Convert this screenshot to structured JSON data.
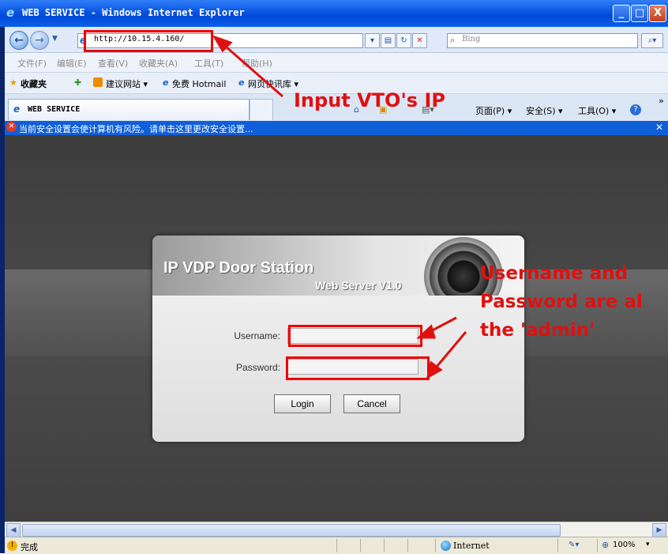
{
  "window": {
    "title": "WEB SERVICE - Windows Internet Explorer",
    "minimize": "_",
    "maximize": "□",
    "close": "X"
  },
  "address_bar": {
    "url": "http://10.15.4.160/",
    "search_placeholder": "Bing"
  },
  "menu": [
    "文件(F)",
    "编辑(E)",
    "查看(V)",
    "收藏夹(A)",
    "工具(T)",
    "帮助(H)"
  ],
  "favorites": {
    "label": "收藏夹",
    "items": [
      "建议网站 ▾",
      "免费 Hotmail",
      "网页快讯库 ▾"
    ]
  },
  "tab": {
    "label": "WEB SERVICE"
  },
  "command_bar": [
    "页面(P) ▾",
    "安全(S) ▾",
    "工具(O) ▾",
    "»"
  ],
  "info_bar": {
    "text": "当前安全设置会使计算机有风险。请单击这里更改安全设置..."
  },
  "login": {
    "title": "IP VDP Door Station",
    "subtitle": "Web Server V1.0",
    "username_label": "Username:",
    "password_label": "Password:",
    "username_value": "",
    "password_value": "",
    "login_button": "Login",
    "cancel_button": "Cancel"
  },
  "annotations": {
    "ip_note": "Input VTO's IP",
    "cred_line1": "Username and",
    "cred_line2": "Password are al",
    "cred_line3": "the 'admin'"
  },
  "status_bar": {
    "text": "完成",
    "zone": "Internet",
    "zoom": "100%"
  },
  "colors": {
    "annotation": "#e01010",
    "titlebar": "#0955e3"
  }
}
